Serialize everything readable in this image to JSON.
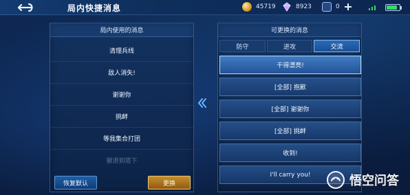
{
  "window": {
    "title": "局内快捷消息"
  },
  "resources": [
    {
      "type": "coin",
      "value": "45719"
    },
    {
      "type": "gem",
      "value": "8923"
    },
    {
      "type": "ticket",
      "value": "0"
    }
  ],
  "status": {
    "battery_level": 0.85,
    "signal_bars": 3,
    "accent": "#39d96a"
  },
  "left_panel": {
    "title": "局内使用的消息",
    "items": [
      "清理兵线",
      "敌人消失!",
      "谢谢你",
      "挑衅",
      "等我集合打团",
      "撤退到塔下"
    ],
    "buttons": {
      "restore": "恢复默认",
      "change": "更换"
    }
  },
  "right_panel": {
    "title": "可更换的消息",
    "tabs": [
      "防守",
      "进攻",
      "交流"
    ],
    "active_tab": "交流",
    "items": [
      "干得漂亮!",
      "[全部] 抱歉",
      "[全部] 谢谢你",
      "[全部] 挑衅",
      "收到!",
      "I'll carry you!"
    ]
  },
  "watermark": {
    "text": "悟空问答"
  }
}
